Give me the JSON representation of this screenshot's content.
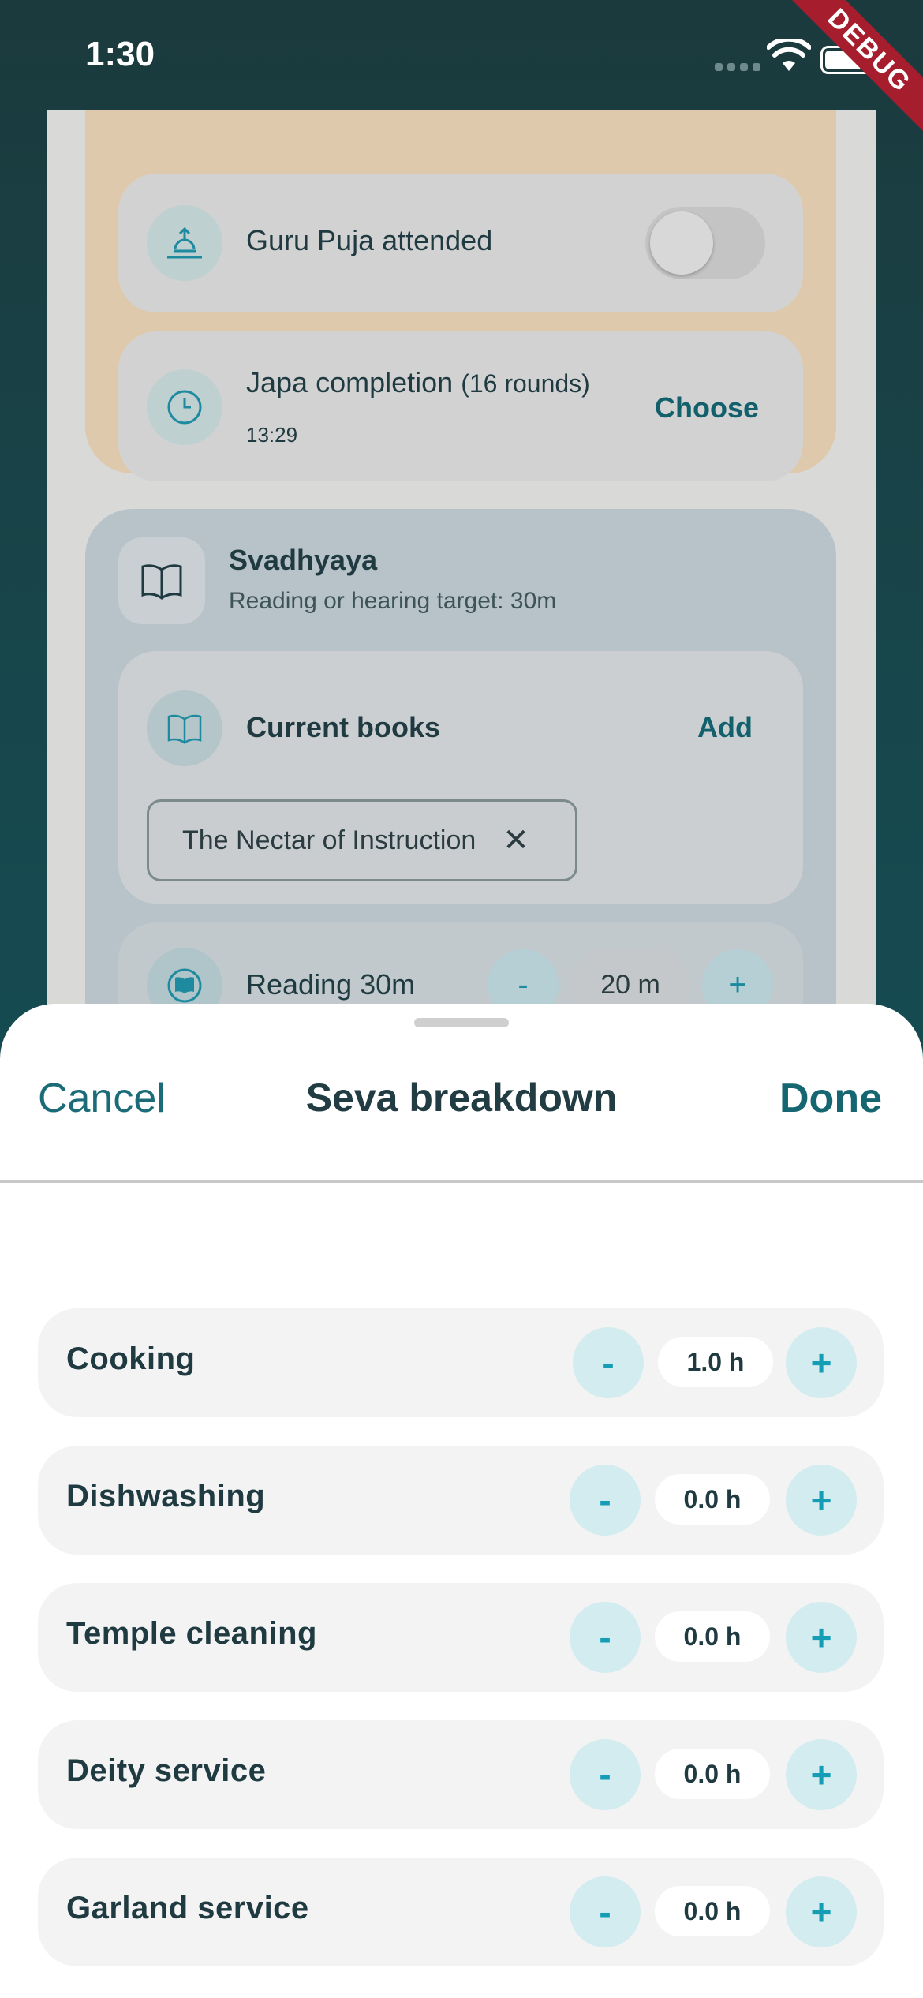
{
  "status_bar": {
    "time": "1:30",
    "debug_banner": "DEBUG"
  },
  "background_page": {
    "guru_puja": {
      "label": "Guru Puja attended",
      "enabled": false
    },
    "japa": {
      "label": "Japa completion",
      "rounds_note": "(16 rounds)",
      "time": "13:29",
      "action": "Choose"
    },
    "svadhyaya": {
      "title": "Svadhyaya",
      "subtitle": "Reading or hearing target: 30m",
      "current_books": {
        "label": "Current books",
        "action": "Add",
        "books": [
          "The Nectar of Instruction"
        ]
      },
      "reading": {
        "label": "Reading 30m",
        "minus": "-",
        "value": "20 m",
        "plus": "+"
      }
    }
  },
  "sheet": {
    "cancel_label": "Cancel",
    "title": "Seva breakdown",
    "done_label": "Done",
    "items": [
      {
        "label": "Cooking",
        "value": "1.0 h",
        "minus": "-",
        "plus": "+"
      },
      {
        "label": "Dishwashing",
        "value": "0.0 h",
        "minus": "-",
        "plus": "+"
      },
      {
        "label": "Temple cleaning",
        "value": "0.0 h",
        "minus": "-",
        "plus": "+"
      },
      {
        "label": "Deity service",
        "value": "0.0 h",
        "minus": "-",
        "plus": "+"
      },
      {
        "label": "Garland service",
        "value": "0.0 h",
        "minus": "-",
        "plus": "+"
      }
    ]
  },
  "colors": {
    "accent": "#156670",
    "button_bg": "#d3ecef",
    "button_fg": "#149db4"
  }
}
